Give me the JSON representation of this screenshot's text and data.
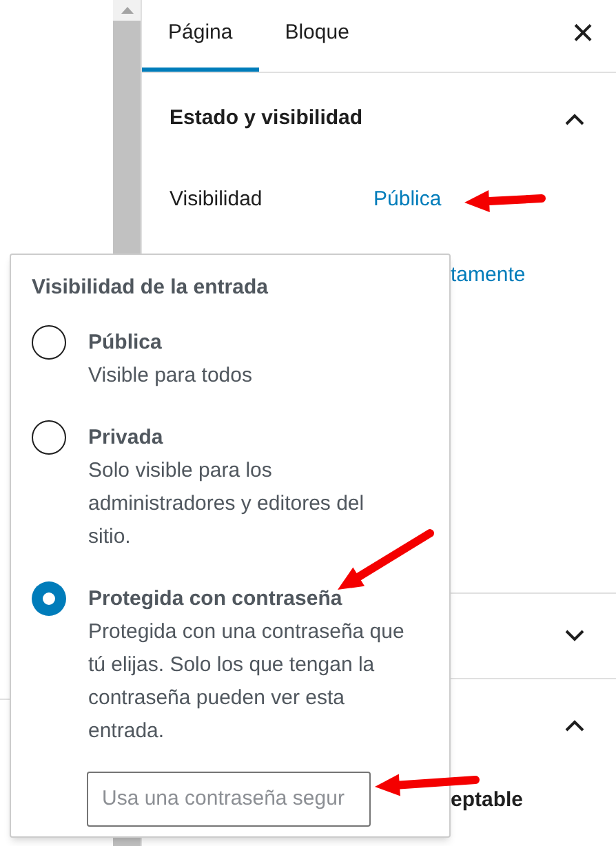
{
  "tabs": [
    {
      "label": "Página",
      "selected": true
    },
    {
      "label": "Bloque",
      "selected": false
    }
  ],
  "close_label": "×",
  "panels": [
    {
      "title": "Estado y visibilidad",
      "expanded": true
    },
    {
      "expanded": false
    },
    {
      "expanded": true
    }
  ],
  "visibility": {
    "label": "Visibilidad",
    "value": "Pública"
  },
  "publish_fragment": "tamente",
  "readability_fragment": "eptable",
  "popover": {
    "title": "Visibilidad de la entrada",
    "options": [
      {
        "label": "Pública",
        "description": "Visible para todos",
        "selected": false
      },
      {
        "label": "Privada",
        "description": "Solo visible para los administradores y editores del sitio.",
        "selected": false
      },
      {
        "label": "Protegida con contraseña",
        "description": "Protegida con una contraseña que tú elijas. Solo los que tengan la contraseña pueden ver esta entrada.",
        "selected": true
      }
    ],
    "password": {
      "placeholder": "Usa una contraseña segur"
    }
  }
}
